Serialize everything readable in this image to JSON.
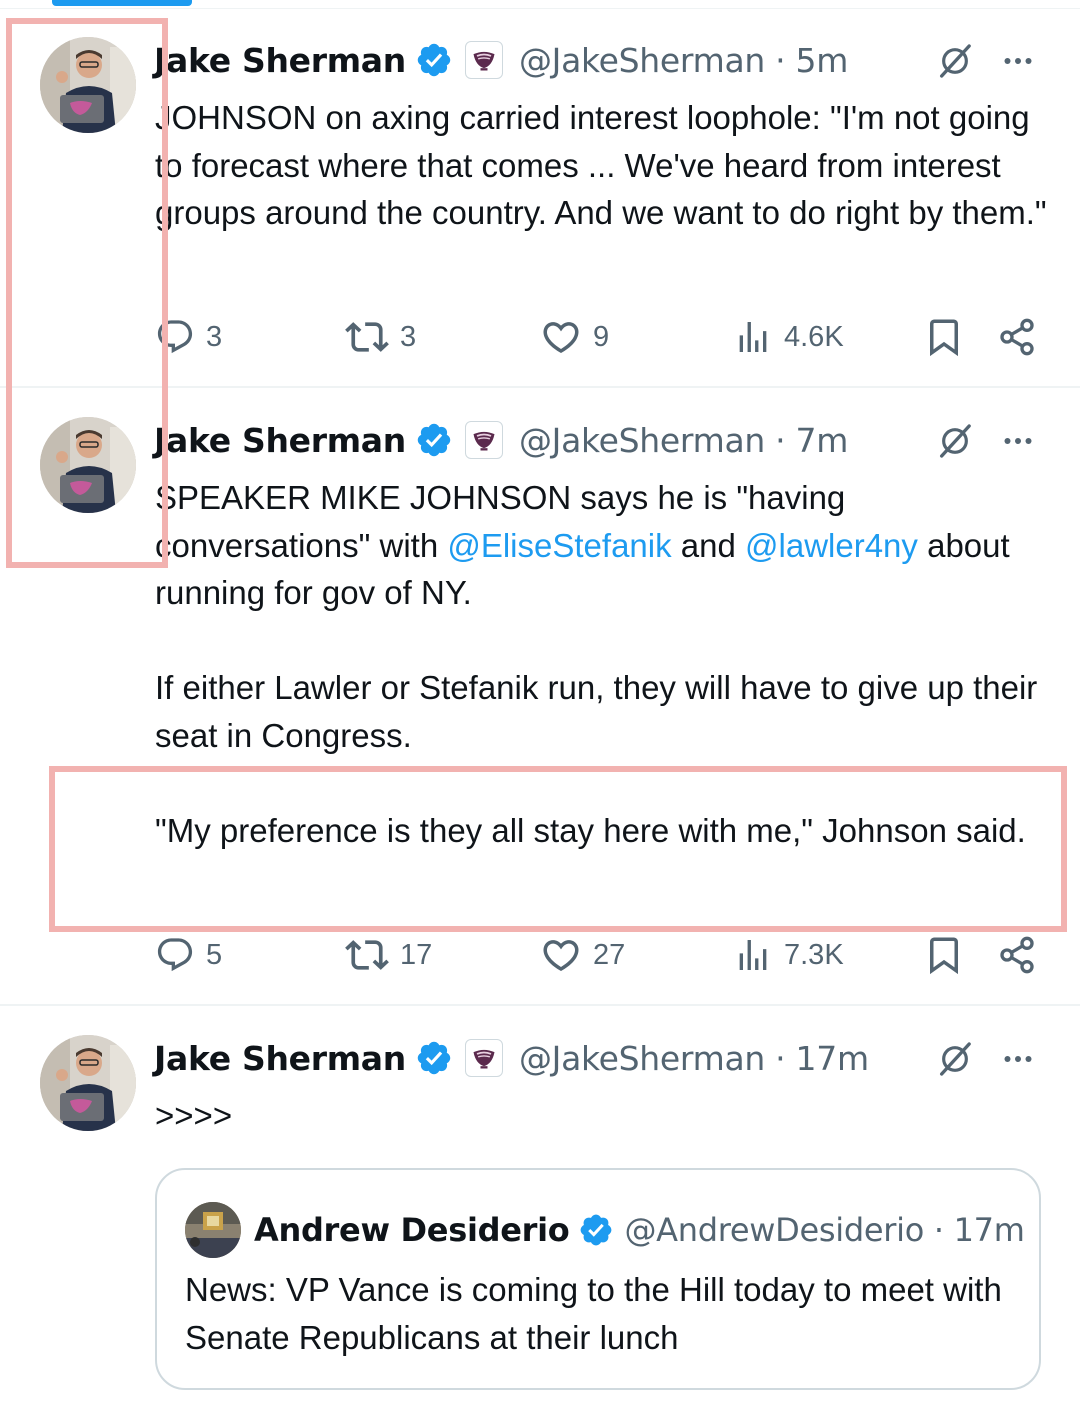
{
  "colors": {
    "accent": "#1d9bf0",
    "secondary_text": "#536471",
    "highlight": "#f2b2b0"
  },
  "tweets": [
    {
      "author": "Jake Sherman",
      "handle_time": "@JakeSherman · 5m",
      "paragraphs": [
        "JOHNSON on axing carried interest loophole: \"I'm not going to forecast where that comes ... We've heard from interest groups around the country. And we want to do right by them.\""
      ],
      "stats": {
        "replies": "3",
        "reposts": "3",
        "likes": "9",
        "views": "4.6K"
      }
    },
    {
      "author": "Jake Sherman",
      "handle_time": "@JakeSherman · 7m",
      "p1_pre": "SPEAKER MIKE JOHNSON says he is \"having conversations\" with ",
      "mention1": "@EliseStefanik",
      "p1_mid": " and ",
      "mention2": "@lawler4ny",
      "p1_post": " about running for gov of NY.",
      "p2": "If either Lawler or Stefanik run, they will have to give up their seat in Congress.",
      "p3": "\"My preference is they all stay here with me,\" Johnson said.",
      "stats": {
        "replies": "5",
        "reposts": "17",
        "likes": "27",
        "views": "7.3K"
      }
    },
    {
      "author": "Jake Sherman",
      "handle_time": "@JakeSherman · 17m",
      "text": ">>>>",
      "quote": {
        "author": "Andrew Desiderio",
        "handle_time": "@AndrewDesiderio · 17m",
        "text": "News: VP Vance is coming to the Hill today to meet with Senate Republicans at their lunch"
      }
    }
  ],
  "icons": {
    "verified": "verified-badge-icon",
    "affiliate": "affiliate-logo-icon",
    "grok": "grok-icon",
    "more": "more-icon",
    "reply": "reply-icon",
    "repost": "repost-icon",
    "like": "like-icon",
    "views": "views-icon",
    "bookmark": "bookmark-icon",
    "share": "share-icon"
  }
}
